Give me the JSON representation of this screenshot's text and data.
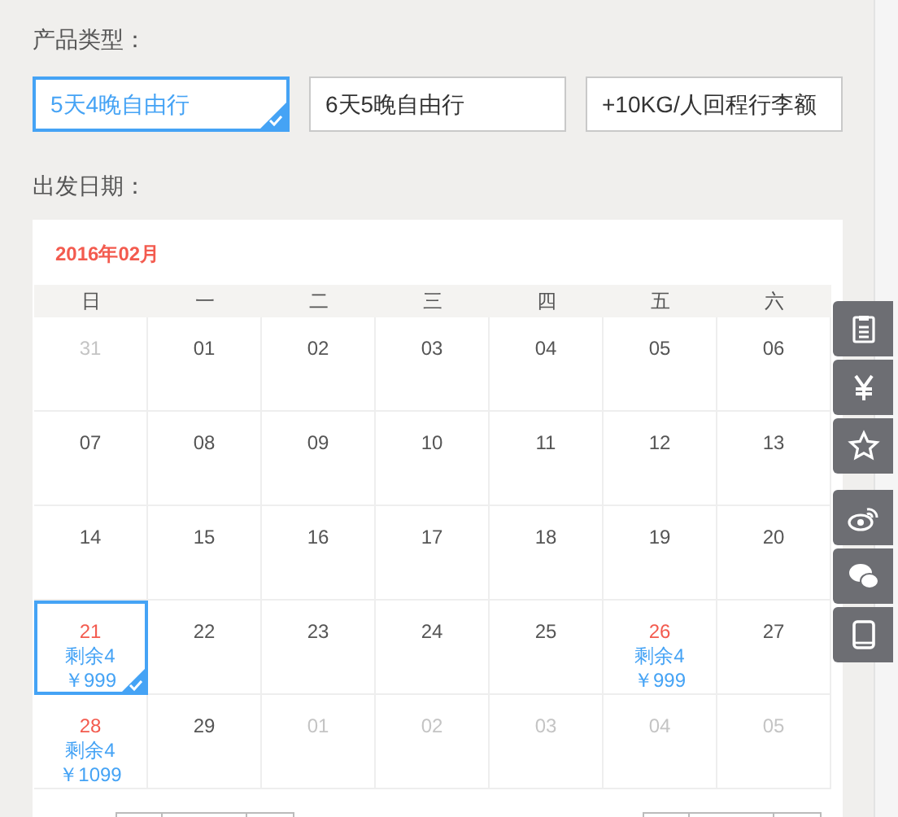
{
  "product_type": {
    "label": "产品类型：",
    "options": [
      {
        "label": "5天4晚自由行",
        "selected": true
      },
      {
        "label": "6天5晚自由行",
        "selected": false
      },
      {
        "label": "+10KG/人回程行李额",
        "selected": false
      }
    ]
  },
  "departure": {
    "label": "出发日期：",
    "month": "2016年02月",
    "weekdays": [
      "日",
      "一",
      "二",
      "三",
      "四",
      "五",
      "六"
    ],
    "days": [
      {
        "day": "31",
        "kind": "other"
      },
      {
        "day": "01",
        "kind": "normal"
      },
      {
        "day": "02",
        "kind": "normal"
      },
      {
        "day": "03",
        "kind": "normal"
      },
      {
        "day": "04",
        "kind": "normal"
      },
      {
        "day": "05",
        "kind": "normal"
      },
      {
        "day": "06",
        "kind": "normal"
      },
      {
        "day": "07",
        "kind": "normal"
      },
      {
        "day": "08",
        "kind": "normal"
      },
      {
        "day": "09",
        "kind": "normal"
      },
      {
        "day": "10",
        "kind": "normal"
      },
      {
        "day": "11",
        "kind": "normal"
      },
      {
        "day": "12",
        "kind": "normal"
      },
      {
        "day": "13",
        "kind": "normal"
      },
      {
        "day": "14",
        "kind": "normal"
      },
      {
        "day": "15",
        "kind": "normal"
      },
      {
        "day": "16",
        "kind": "normal"
      },
      {
        "day": "17",
        "kind": "normal"
      },
      {
        "day": "18",
        "kind": "normal"
      },
      {
        "day": "19",
        "kind": "normal"
      },
      {
        "day": "20",
        "kind": "normal"
      },
      {
        "day": "21",
        "kind": "available",
        "remain": "剩余4",
        "price": "￥999",
        "selected": true
      },
      {
        "day": "22",
        "kind": "normal"
      },
      {
        "day": "23",
        "kind": "normal"
      },
      {
        "day": "24",
        "kind": "normal"
      },
      {
        "day": "25",
        "kind": "normal"
      },
      {
        "day": "26",
        "kind": "available",
        "remain": "剩余4",
        "price": "￥999",
        "selected": false
      },
      {
        "day": "27",
        "kind": "normal"
      },
      {
        "day": "28",
        "kind": "available",
        "remain": "剩余4",
        "price": "￥1099",
        "selected": false
      },
      {
        "day": "29",
        "kind": "normal"
      },
      {
        "day": "01",
        "kind": "other"
      },
      {
        "day": "02",
        "kind": "other"
      },
      {
        "day": "03",
        "kind": "other"
      },
      {
        "day": "04",
        "kind": "other"
      },
      {
        "day": "05",
        "kind": "other"
      }
    ]
  },
  "side_toolbar": [
    {
      "kind": "list"
    },
    {
      "kind": "yuan"
    },
    {
      "kind": "star"
    },
    {
      "kind": "weibo"
    },
    {
      "kind": "wechat"
    },
    {
      "kind": "tablet"
    }
  ]
}
